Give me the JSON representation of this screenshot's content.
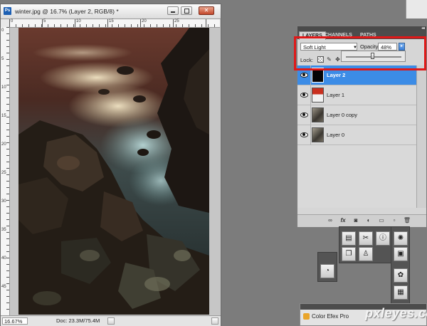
{
  "document": {
    "title": "winter.jpg @ 16.7% (Layer 2, RGB/8) *",
    "app_icon": "Ps",
    "close_glyph": "✕",
    "zoom": "16.67%",
    "doc_info": "Doc: 23.3M/75.4M",
    "ruler_top_numbers": [
      "0",
      "5",
      "10",
      "15",
      "20",
      "25"
    ],
    "ruler_left_numbers": [
      "0",
      "5",
      "10",
      "15",
      "20",
      "25",
      "30",
      "35",
      "40",
      "45"
    ]
  },
  "layers_panel": {
    "tabs": [
      "LAYERS",
      "CHANNELS",
      "PATHS"
    ],
    "collapse_glyph": "◂◂",
    "blend_mode": "Soft Light",
    "opacity_label": "Opacity:",
    "opacity_value": "48%",
    "opacity_fraction": 0.48,
    "lock_label": "Lock:",
    "layers": [
      {
        "name": "Layer 2",
        "selected": true,
        "thumb": "black"
      },
      {
        "name": "Layer 1",
        "selected": false,
        "thumb": "red-white"
      },
      {
        "name": "Layer 0 copy",
        "selected": false,
        "thumb": "photo"
      },
      {
        "name": "Layer 0",
        "selected": false,
        "thumb": "photo"
      }
    ],
    "footer_icons": [
      "link-icon",
      "fx-icon",
      "mask-icon",
      "adjustment-icon",
      "folder-icon",
      "new-layer-icon",
      "trash-icon"
    ],
    "footer_glyphs": [
      "∞",
      "fx",
      "◙",
      "◐",
      "▭",
      "▫",
      "🗑"
    ]
  },
  "colorefex_panel": {
    "title": "Color Efex Pro"
  },
  "watermark": "pxleyes.com",
  "colors": {
    "selection_blue": "#3c8ce6",
    "highlight_red": "#e01818",
    "workspace_gray": "#7c7c7c"
  }
}
